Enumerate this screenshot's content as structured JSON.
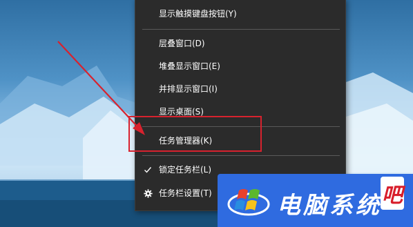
{
  "context_menu": {
    "items": [
      {
        "label": "显示触摸键盘按钮(Y)",
        "icon": ""
      },
      {
        "label": "层叠窗口(D)",
        "icon": ""
      },
      {
        "label": "堆叠显示窗口(E)",
        "icon": ""
      },
      {
        "label": "并排显示窗口(I)",
        "icon": ""
      },
      {
        "label": "显示桌面(S)",
        "icon": ""
      },
      {
        "label": "任务管理器(K)",
        "icon": ""
      },
      {
        "label": "锁定任务栏(L)",
        "icon": "checkmark-icon"
      },
      {
        "label": "任务栏设置(T)",
        "icon": "gear-icon"
      }
    ],
    "highlight_color": "#d8222e"
  },
  "watermark": {
    "text": "电脑系统",
    "badge": "吧",
    "bg_color": "#2f6be0"
  }
}
